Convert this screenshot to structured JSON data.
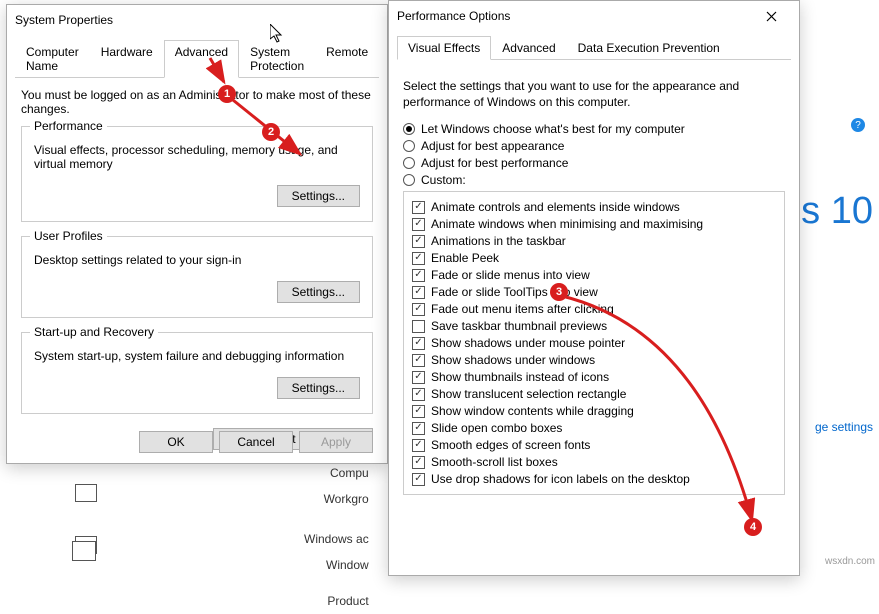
{
  "bg": {
    "ten": "s 10",
    "link": "ge settings",
    "watermark": "wsxdn.com",
    "labels": [
      "Compu",
      "Workgro",
      "Windows ac",
      "Window",
      "Product"
    ]
  },
  "sysprops": {
    "title": "System Properties",
    "tabs": [
      "Computer Name",
      "Hardware",
      "Advanced",
      "System Protection",
      "Remote"
    ],
    "activeTab": 2,
    "note": "You must be logged on as an Administrator to make most of these changes.",
    "groups": {
      "perf": {
        "title": "Performance",
        "desc": "Visual effects, processor scheduling, memory usage, and virtual memory",
        "btn": "Settings..."
      },
      "user": {
        "title": "User Profiles",
        "desc": "Desktop settings related to your sign-in",
        "btn": "Settings..."
      },
      "startup": {
        "title": "Start-up and Recovery",
        "desc": "System start-up, system failure and debugging information",
        "btn": "Settings..."
      }
    },
    "env": "Environment Variables...",
    "ok": "OK",
    "cancel": "Cancel",
    "apply": "Apply"
  },
  "perfopts": {
    "title": "Performance Options",
    "tabs": [
      "Visual Effects",
      "Advanced",
      "Data Execution Prevention"
    ],
    "activeTab": 0,
    "note": "Select the settings that you want to use for the appearance and performance of Windows on this computer.",
    "radios": [
      {
        "label": "Let Windows choose what's best for my computer",
        "selected": true
      },
      {
        "label": "Adjust for best appearance",
        "selected": false
      },
      {
        "label": "Adjust for best performance",
        "selected": false
      },
      {
        "label": "Custom:",
        "selected": false
      }
    ],
    "checks": [
      {
        "label": "Animate controls and elements inside windows",
        "on": true
      },
      {
        "label": "Animate windows when minimising and maximising",
        "on": true
      },
      {
        "label": "Animations in the taskbar",
        "on": true
      },
      {
        "label": "Enable Peek",
        "on": true
      },
      {
        "label": "Fade or slide menus into view",
        "on": true
      },
      {
        "label": "Fade or slide ToolTips into view",
        "on": true
      },
      {
        "label": "Fade out menu items after clicking",
        "on": true
      },
      {
        "label": "Save taskbar thumbnail previews",
        "on": false
      },
      {
        "label": "Show shadows under mouse pointer",
        "on": true
      },
      {
        "label": "Show shadows under windows",
        "on": true
      },
      {
        "label": "Show thumbnails instead of icons",
        "on": true
      },
      {
        "label": "Show translucent selection rectangle",
        "on": true
      },
      {
        "label": "Show window contents while dragging",
        "on": true
      },
      {
        "label": "Slide open combo boxes",
        "on": true
      },
      {
        "label": "Smooth edges of screen fonts",
        "on": true
      },
      {
        "label": "Smooth-scroll list boxes",
        "on": true
      },
      {
        "label": "Use drop shadows for icon labels on the desktop",
        "on": true
      }
    ]
  },
  "steps": {
    "1": "1",
    "2": "2",
    "3": "3",
    "4": "4"
  }
}
